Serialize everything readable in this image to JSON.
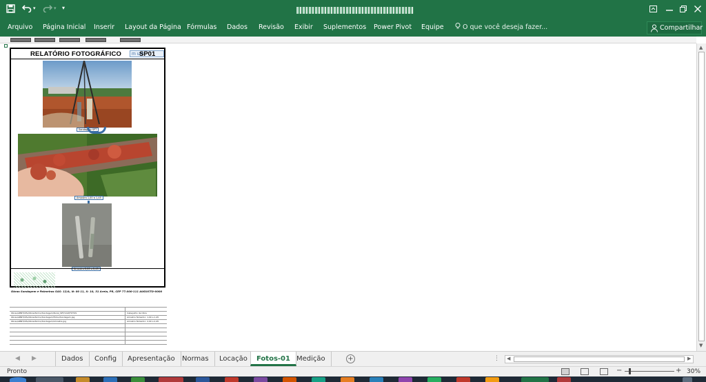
{
  "titlebar": {
    "save_icon": "save-icon",
    "undo_icon": "undo-icon",
    "redo_icon": "redo-icon",
    "window_buttons": [
      "ribbon-display-icon",
      "minimize-icon",
      "restore-icon",
      "close-icon"
    ]
  },
  "ribbon": {
    "tabs": [
      "Arquivo",
      "Página Inicial",
      "Inserir",
      "Layout da Página",
      "Fórmulas",
      "Dados",
      "Revisão",
      "Exibir",
      "Suplementos",
      "Power Pivot",
      "Equipe"
    ],
    "tell_me": "O que você deseja fazer...",
    "share": "Compartilhar"
  },
  "report": {
    "title": "RELATÓRIO FOTOGRÁFICO",
    "code": "SP01",
    "logo": "m      um",
    "photos": [
      {
        "caption": "Sondagem SPT",
        "icon": "drilling-rig-photo"
      },
      {
        "caption": "Amostra 1,00 a 1,45",
        "icon": "soil-sample-photo"
      },
      {
        "caption": "Amostra 2,00 a 2,45",
        "icon": "sampler-tube-photo"
      }
    ],
    "footer": "Obras Sondagem e Palmeiras SAS: 12/A, N: 00 11, X: 10, 31 Areia, PR, CEP 77.000-111  AUGUSTO-0000"
  },
  "mini_table": {
    "rows_left": [
      "Obras/ABNT/CEs/ObrasTermo/Sondagem/Rural_SPT/CAD/FOTOS",
      "Obras/ABNT/CEs/ObrasTermo/Sondagem/Fotos/Sondagem.jpg",
      "Obras/ABNT/CEs/ObrasTermo/Sondagem/Amostra.jpg"
    ],
    "rows_right": [
      "Cabeçalho de Obra",
      "Amostra Tamanho: 1,00 a 1,45",
      "Amostra Tamanho: 2,00 a 2,45"
    ]
  },
  "sheet_tabs": [
    "Dados",
    "Config",
    "Apresentação",
    "Normas",
    "Locação",
    "Fotos-01",
    "Medição"
  ],
  "active_tab": "Fotos-01",
  "status": {
    "text": "Pronto",
    "zoom": "30%"
  },
  "colors": {
    "excel_green": "#217346"
  }
}
